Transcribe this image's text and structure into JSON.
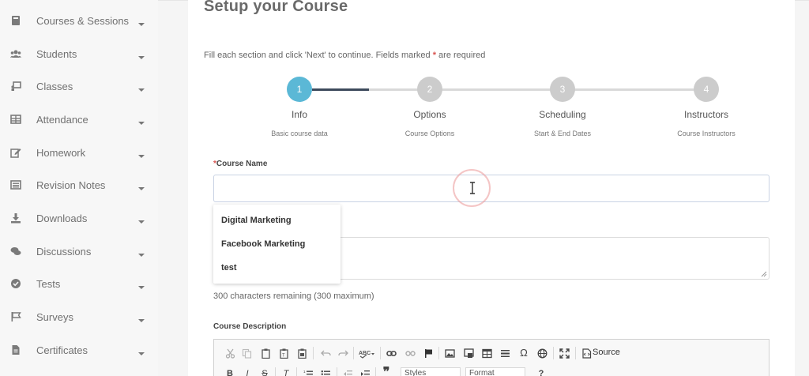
{
  "sidebar": {
    "items": [
      {
        "label": "Courses & Sessions",
        "icon": "book-icon"
      },
      {
        "label": "Students",
        "icon": "users-icon"
      },
      {
        "label": "Classes",
        "icon": "chalkboard-icon"
      },
      {
        "label": "Attendance",
        "icon": "table-icon"
      },
      {
        "label": "Homework",
        "icon": "edit-icon"
      },
      {
        "label": "Revision Notes",
        "icon": "list-alt-icon"
      },
      {
        "label": "Downloads",
        "icon": "download-icon"
      },
      {
        "label": "Discussions",
        "icon": "comments-icon"
      },
      {
        "label": "Tests",
        "icon": "check-circle-icon"
      },
      {
        "label": "Surveys",
        "icon": "flag-icon"
      },
      {
        "label": "Certificates",
        "icon": "file-icon"
      }
    ]
  },
  "page": {
    "title": "Setup your Course",
    "intro_before": "Fill each section and click 'Next' to continue. Fields marked ",
    "intro_star": "*",
    "intro_after": " are required"
  },
  "stepper": {
    "active_color": "#5bb8d6",
    "inactive_color": "#cccccc",
    "done_line_color": "#3d4a5c",
    "steps": [
      {
        "number": "1",
        "title": "Info",
        "subtitle": "Basic course data"
      },
      {
        "number": "2",
        "title": "Options",
        "subtitle": "Course Options"
      },
      {
        "number": "3",
        "title": "Scheduling",
        "subtitle": "Start & End Dates"
      },
      {
        "number": "4",
        "title": "Instructors",
        "subtitle": "Course Instructors"
      }
    ]
  },
  "form": {
    "course_name_star": "*",
    "course_name_label": "Course Name",
    "course_name_value": "",
    "suggestions": [
      "Digital Marketing",
      "Facebook Marketing",
      "test"
    ],
    "chars_remaining": "300 characters remaining (300 maximum)",
    "description_label": "Course Description"
  },
  "editor": {
    "source_label": "Source",
    "styles_label": "Styles",
    "format_label": "Format"
  }
}
